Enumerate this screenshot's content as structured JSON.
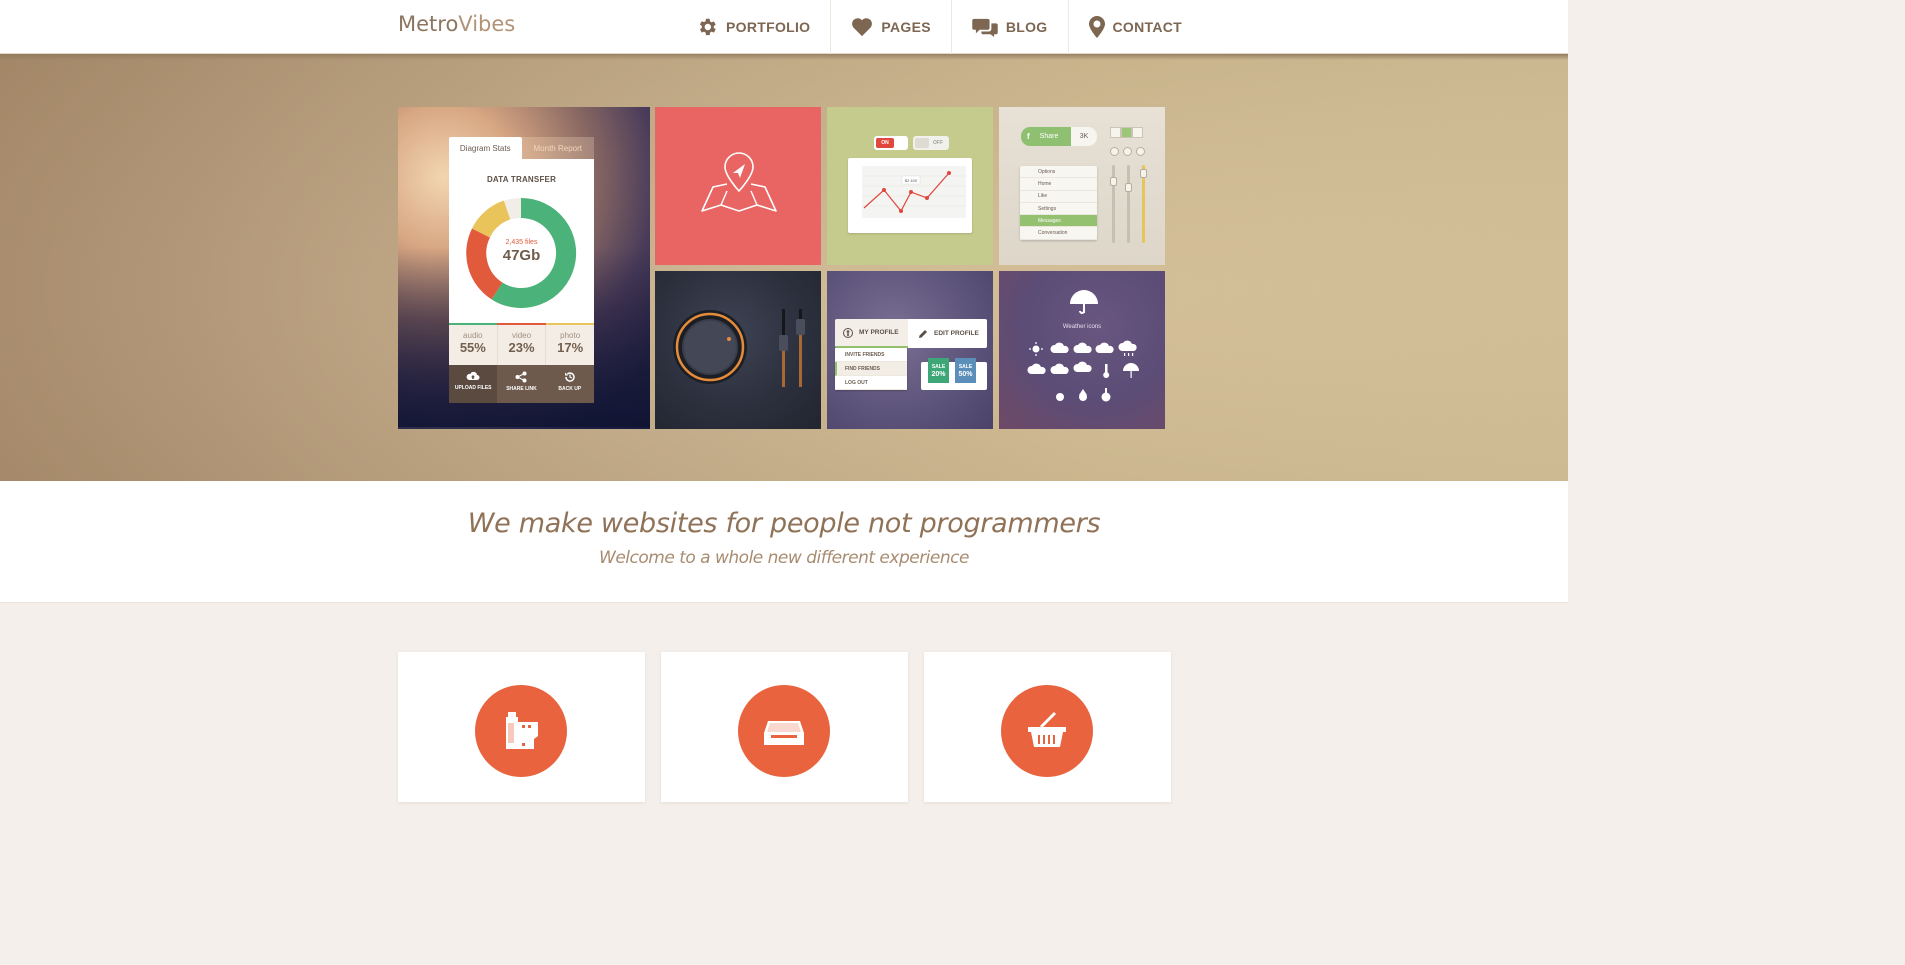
{
  "header": {
    "logo_part1": "Metro",
    "logo_part2": "Vibes",
    "nav": [
      {
        "label": "PORTFOLIO",
        "icon": "gear-icon"
      },
      {
        "label": "PAGES",
        "icon": "heart-icon"
      },
      {
        "label": "BLOG",
        "icon": "chat-bubbles-icon"
      },
      {
        "label": "CONTACT",
        "icon": "map-pin-icon"
      }
    ]
  },
  "portfolio": {
    "stats_card": {
      "tab_active": "Diagram Stats",
      "tab_inactive": "Month Report",
      "title": "DATA TRANSFER",
      "files": "2,435 files",
      "total": "47Gb",
      "stats": [
        {
          "label": "audio",
          "value": "55%",
          "color": "#e25a3c"
        },
        {
          "label": "video",
          "value": "23%",
          "color": "#4bb27a"
        },
        {
          "label": "photo",
          "value": "17%",
          "color": "#e8c45b"
        }
      ],
      "actions": [
        "UPLOAD FILES",
        "SHARE LINK",
        "BACK UP"
      ]
    },
    "chart_tile": {
      "toggle_on": "ON",
      "toggle_off": "OFF",
      "tooltip": "$2 400"
    },
    "widgets_tile": {
      "share_label": "Share",
      "share_count": "3K",
      "menu": [
        "Options",
        "Home",
        "Like",
        "Settings",
        "Messages",
        "Conversation"
      ]
    },
    "profile_tile": {
      "my_profile": "MY PROFILE",
      "edit_profile": "EDIT PROFILE",
      "menu": [
        "INVITE FRIENDS",
        "FIND FRIENDS",
        "LOG OUT"
      ],
      "sale_label": "SALE",
      "sale_1": "20%",
      "sale_2": "50%"
    },
    "weather_tile": {
      "label": "Weather icons"
    }
  },
  "tagline": {
    "title": "We make websites for people not programmers",
    "subtitle": "Welcome to a whole new different experience"
  },
  "features": [
    {
      "icon": "film-canister-icon"
    },
    {
      "icon": "drive-icon"
    },
    {
      "icon": "basket-icon"
    }
  ],
  "colors": {
    "accent": "#e8633e",
    "brand": "#8c7660"
  }
}
